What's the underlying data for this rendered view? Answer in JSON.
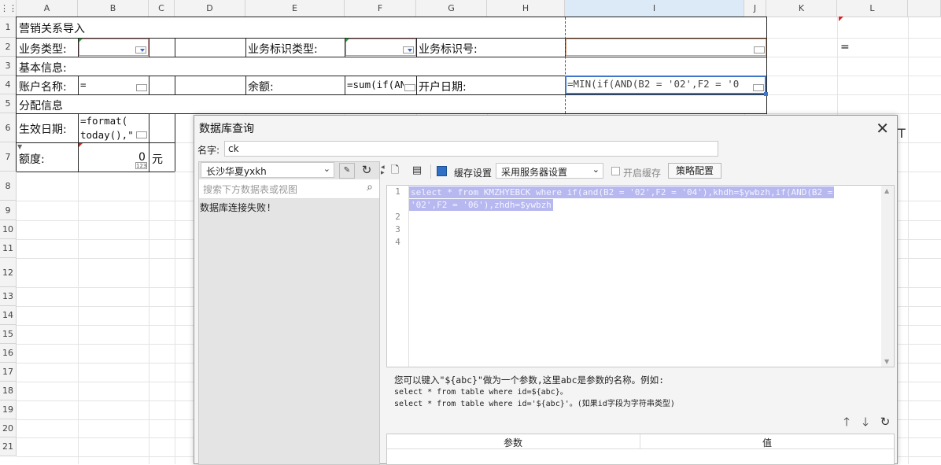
{
  "sheet": {
    "columns": [
      "A",
      "B",
      "C",
      "D",
      "E",
      "F",
      "G",
      "H",
      "I",
      "J",
      "K",
      "L"
    ],
    "rows": [
      "1",
      "2",
      "3",
      "4",
      "5",
      "6",
      "7",
      "8",
      "9",
      "10",
      "11",
      "12",
      "13",
      "14",
      "15",
      "16",
      "17",
      "18",
      "19",
      "20",
      "21"
    ],
    "cells": {
      "a1": "营销关系导入",
      "a2": "业务类型:",
      "e2": "业务标识类型:",
      "g2": "业务标识号:",
      "l2": "=",
      "a3": "基本信息:",
      "a4": "账户名称:",
      "b4": "=",
      "e4": "余额:",
      "f4": "=sum(if(AN",
      "g4": "开户日期:",
      "i4": "=MIN(if(AND(B2 = '02',F2 = '0",
      "a5": "分配信息",
      "a6": "生效日期:",
      "b6_line1": "=format(",
      "b6_line2": "today(),\"",
      "a7": "额度:",
      "b7": "0",
      "c7": "元"
    }
  },
  "dialog": {
    "title": "数据库查询",
    "close_glyph": "✕",
    "name_label": "名字:",
    "name_value": "ck",
    "datasource": "长沙华夏yxkh",
    "search_placeholder": "搜索下方数据表或视图",
    "connection_error": "数据库连接失败!",
    "cache_label": "缓存设置",
    "cache_option": "采用服务器设置",
    "enable_cache_label": "开启缓存",
    "strategy_button": "策略配置",
    "sql_line1a": "select * from KMZHYEBCK where if(and(B2 = '02',F2 = '04'),khdh=$ywbzh,if(AND(B2 =",
    "sql_line1b": "'02',F2 = '06'),zhdh=$ywbzh",
    "line_numbers": [
      "1",
      "2",
      "3",
      "4"
    ],
    "hint_line1": "您可以键入\"${abc}\"做为一个参数,这里abc是参数的名称。例如:",
    "hint_line2": "select * from table where id=${abc}。",
    "hint_line3": "select * from table where id='${abc}'。(如果id字段为字符串类型)",
    "param_col": "参数",
    "value_col": "值"
  }
}
